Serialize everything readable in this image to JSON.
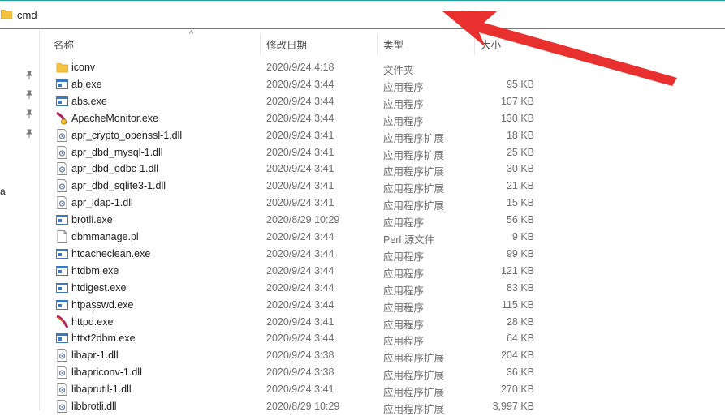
{
  "address_bar": {
    "path": "cmd",
    "icon": "folder-icon"
  },
  "left_pane": {
    "pins": [
      "pin-icon",
      "pin-icon",
      "pin-icon",
      "pin-icon"
    ],
    "partial_label": "a"
  },
  "columns": {
    "name": "名称",
    "date": "修改日期",
    "type": "类型",
    "size": "大小"
  },
  "files": [
    {
      "name": "iconv",
      "date": "2020/9/24 4:18",
      "type": "文件夹",
      "size": "",
      "icon": "folder"
    },
    {
      "name": "ab.exe",
      "date": "2020/9/24 3:44",
      "type": "应用程序",
      "size": "95 KB",
      "icon": "exe"
    },
    {
      "name": "abs.exe",
      "date": "2020/9/24 3:44",
      "type": "应用程序",
      "size": "107 KB",
      "icon": "exe"
    },
    {
      "name": "ApacheMonitor.exe",
      "date": "2020/9/24 3:44",
      "type": "应用程序",
      "size": "130 KB",
      "icon": "apache"
    },
    {
      "name": "apr_crypto_openssl-1.dll",
      "date": "2020/9/24 3:41",
      "type": "应用程序扩展",
      "size": "18 KB",
      "icon": "dll"
    },
    {
      "name": "apr_dbd_mysql-1.dll",
      "date": "2020/9/24 3:41",
      "type": "应用程序扩展",
      "size": "25 KB",
      "icon": "dll"
    },
    {
      "name": "apr_dbd_odbc-1.dll",
      "date": "2020/9/24 3:41",
      "type": "应用程序扩展",
      "size": "30 KB",
      "icon": "dll"
    },
    {
      "name": "apr_dbd_sqlite3-1.dll",
      "date": "2020/9/24 3:41",
      "type": "应用程序扩展",
      "size": "21 KB",
      "icon": "dll"
    },
    {
      "name": "apr_ldap-1.dll",
      "date": "2020/9/24 3:41",
      "type": "应用程序扩展",
      "size": "15 KB",
      "icon": "dll"
    },
    {
      "name": "brotli.exe",
      "date": "2020/8/29 10:29",
      "type": "应用程序",
      "size": "56 KB",
      "icon": "exe"
    },
    {
      "name": "dbmmanage.pl",
      "date": "2020/9/24 3:44",
      "type": "Perl 源文件",
      "size": "9 KB",
      "icon": "doc"
    },
    {
      "name": "htcacheclean.exe",
      "date": "2020/9/24 3:44",
      "type": "应用程序",
      "size": "99 KB",
      "icon": "exe"
    },
    {
      "name": "htdbm.exe",
      "date": "2020/9/24 3:44",
      "type": "应用程序",
      "size": "121 KB",
      "icon": "exe"
    },
    {
      "name": "htdigest.exe",
      "date": "2020/9/24 3:44",
      "type": "应用程序",
      "size": "83 KB",
      "icon": "exe"
    },
    {
      "name": "htpasswd.exe",
      "date": "2020/9/24 3:44",
      "type": "应用程序",
      "size": "115 KB",
      "icon": "exe"
    },
    {
      "name": "httpd.exe",
      "date": "2020/9/24 3:41",
      "type": "应用程序",
      "size": "28 KB",
      "icon": "feather"
    },
    {
      "name": "httxt2dbm.exe",
      "date": "2020/9/24 3:44",
      "type": "应用程序",
      "size": "64 KB",
      "icon": "exe"
    },
    {
      "name": "libapr-1.dll",
      "date": "2020/9/24 3:38",
      "type": "应用程序扩展",
      "size": "204 KB",
      "icon": "dll"
    },
    {
      "name": "libapriconv-1.dll",
      "date": "2020/9/24 3:38",
      "type": "应用程序扩展",
      "size": "36 KB",
      "icon": "dll"
    },
    {
      "name": "libaprutil-1.dll",
      "date": "2020/9/24 3:41",
      "type": "应用程序扩展",
      "size": "270 KB",
      "icon": "dll"
    },
    {
      "name": "libbrotli.dll",
      "date": "2020/8/29 10:29",
      "type": "应用程序扩展",
      "size": "3,997 KB",
      "icon": "dll"
    }
  ],
  "colors": {
    "accent_border": "#1aa19a",
    "arrow": "#e8302f",
    "folder": "#f5c342"
  }
}
